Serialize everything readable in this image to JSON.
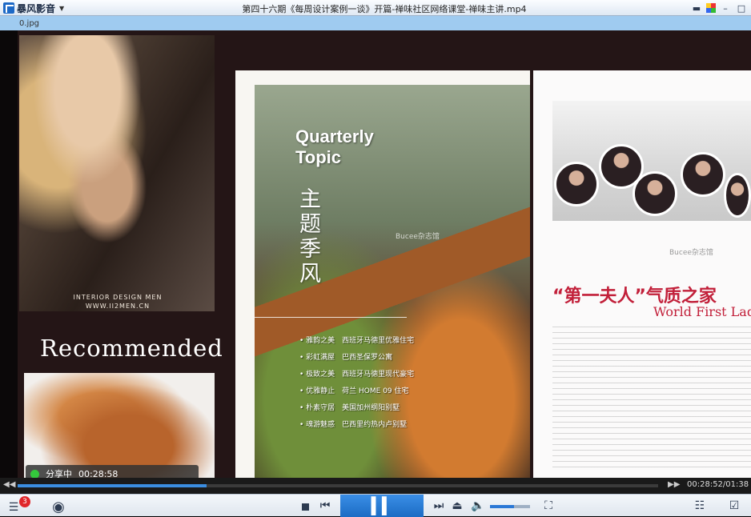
{
  "window": {
    "app_name": "暴风影音",
    "title": "第四十六期《每周设计案例一谈》开篇-禅味社区网络课堂-禅味主讲.mp4"
  },
  "video": {
    "top_filename": "0.jpg",
    "left_ad": {
      "caption_line1": "INTERIOR DESIGN MEN",
      "caption_line2": "WWW.II2MEN.CN",
      "recommended": "Recommended"
    },
    "share": {
      "label": "分享中",
      "time": "00:28:58",
      "status_color": "#34c83c"
    },
    "page1": {
      "title_line1": "Quarterly",
      "title_line2": "Topic",
      "chinese_title": "主题季风",
      "brand": "Bucee杂志馆",
      "topics": [
        "雅韵之美　西班牙马德里优雅住宅",
        "彩虹满屋　巴西圣保罗公寓",
        "极致之美　西班牙马德里现代豪宅",
        "优雅静止　荷兰 HOME 09 住宅",
        "朴素守居　美国加州纲阳别墅",
        "魂游魅惑　巴西里约热内卢别墅"
      ]
    },
    "page2": {
      "brand": "Bucee杂志馆",
      "title_cn": "“第一夫人”气质之家",
      "title_en": "World First Lady St",
      "accent_color": "#c2203a"
    }
  },
  "player": {
    "progress_fraction": 0.295,
    "time_display": "00:28:52/01:38",
    "notification_count": "3",
    "volume_fraction": 0.6,
    "accent_color": "#2b78d6"
  }
}
